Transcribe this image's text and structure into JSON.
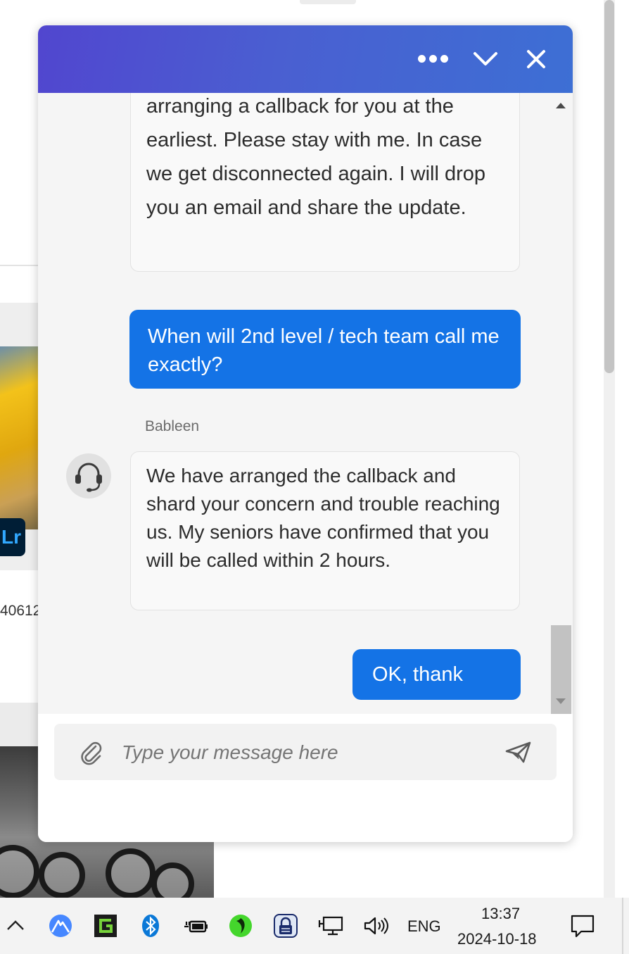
{
  "chat": {
    "header": {
      "more_icon": "more-horizontal-icon",
      "minimize_icon": "chevron-down-icon",
      "close_icon": "close-icon"
    },
    "messages": [
      {
        "from": "agent",
        "lines": [
          "arranging a callback for you at the",
          "earliest. Please stay with me. In case",
          "we get disconnected again. I will drop",
          "you an email and share the update."
        ]
      },
      {
        "from": "user",
        "text": "When will 2nd level / tech team call me exactly?"
      },
      {
        "from": "agent",
        "sender": "Bableen",
        "avatar_icon": "headset-icon",
        "text": "We have arranged the callback and shard your concern and trouble reaching us. My seniors have confirmed that you will be called within 2 hours."
      },
      {
        "from": "user",
        "text": "OK, thank you"
      }
    ],
    "composer": {
      "placeholder": "Type your message here",
      "value": "",
      "attach_icon": "paperclip-icon",
      "send_icon": "send-icon"
    },
    "colors": {
      "header_start": "#5146cf",
      "header_end": "#3d6fd4",
      "user_bubble": "#1473e6",
      "agent_bubble": "#f9f9f9"
    }
  },
  "background_page": {
    "lr_badge": "Lr",
    "partial_number": "40612"
  },
  "taskbar": {
    "language": "ENG",
    "time": "13:37",
    "date": "2024-10-18",
    "icons": [
      "chevron-up-icon",
      "nordvpn-icon",
      "gpu-monitor-icon",
      "bluetooth-icon",
      "power-icon",
      "razer-icon",
      "lock-icon",
      "network-icon",
      "volume-icon",
      "notification-icon"
    ]
  }
}
